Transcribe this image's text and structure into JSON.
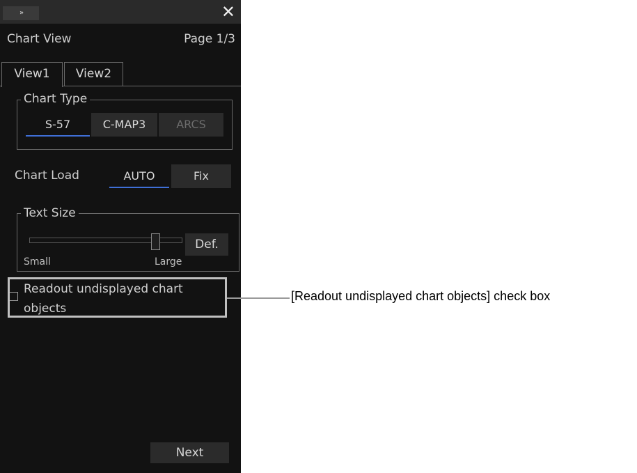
{
  "window": {
    "expand_icon": "»",
    "close_icon": "✕",
    "title": "Chart View",
    "page": "Page 1/3"
  },
  "tabs": [
    {
      "label": "View1",
      "selected": true
    },
    {
      "label": "View2",
      "selected": false
    }
  ],
  "chart_type": {
    "legend": "Chart Type",
    "options": [
      {
        "label": "S-57",
        "state": "selected"
      },
      {
        "label": "C-MAP3",
        "state": "normal"
      },
      {
        "label": "ARCS",
        "state": "disabled"
      }
    ]
  },
  "chart_load": {
    "label": "Chart Load",
    "options": [
      {
        "label": "AUTO",
        "state": "selected"
      },
      {
        "label": "Fix",
        "state": "normal"
      }
    ]
  },
  "text_size": {
    "legend": "Text Size",
    "default_button": "Def.",
    "min_label": "Small",
    "max_label": "Large",
    "level_fraction": 0.83
  },
  "readout_checkbox": {
    "label": "Readout undisplayed chart objects",
    "checked": false
  },
  "footer": {
    "next_button": "Next"
  },
  "annotation": {
    "callout": "[Readout undisplayed chart objects] check box"
  },
  "colors": {
    "panel_bg": "#121212",
    "selection_underline": "#3f6fd6",
    "highlight_frame": "#c0c0c0"
  }
}
